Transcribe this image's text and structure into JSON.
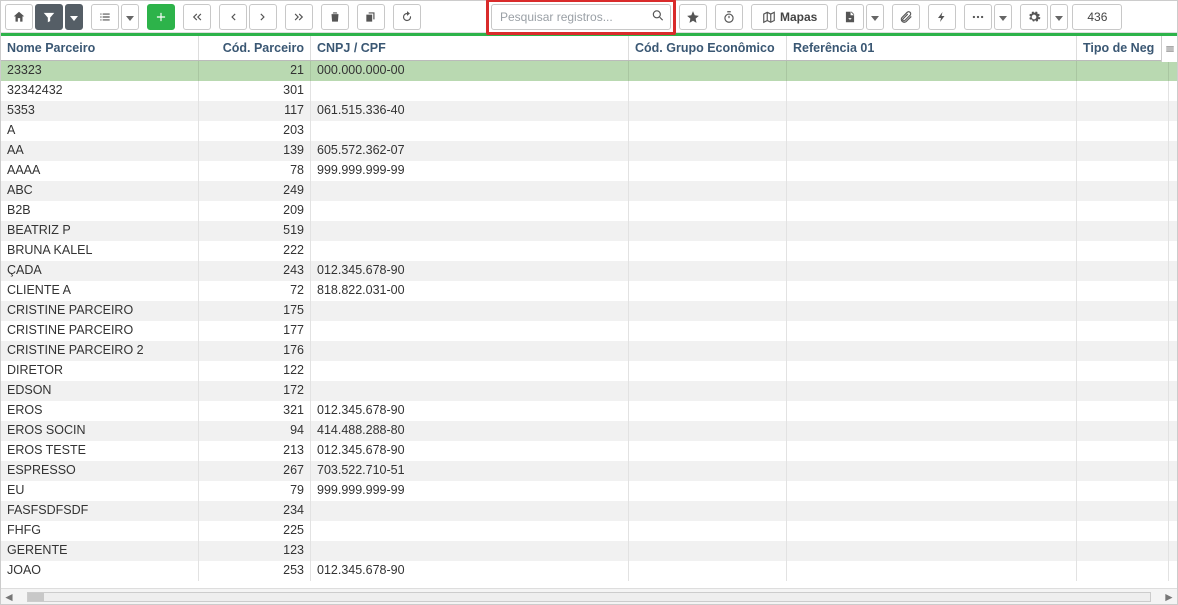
{
  "toolbar": {
    "search_placeholder": "Pesquisar registros...",
    "mapas_label": "Mapas",
    "record_count": "436"
  },
  "table": {
    "columns": [
      "Nome Parceiro",
      "Cód. Parceiro",
      "CNPJ / CPF",
      "Cód. Grupo Econômico",
      "Referência 01",
      "Tipo de Neg"
    ],
    "rows": [
      {
        "nome": "23323",
        "cod": "21",
        "cnpj": "000.000.000-00",
        "grupo": "",
        "ref": "",
        "tipo": "",
        "selected": true
      },
      {
        "nome": "32342432",
        "cod": "301",
        "cnpj": "",
        "grupo": "",
        "ref": "",
        "tipo": ""
      },
      {
        "nome": "5353",
        "cod": "117",
        "cnpj": "061.515.336-40",
        "grupo": "",
        "ref": "",
        "tipo": ""
      },
      {
        "nome": "A",
        "cod": "203",
        "cnpj": "",
        "grupo": "",
        "ref": "",
        "tipo": ""
      },
      {
        "nome": "AA",
        "cod": "139",
        "cnpj": "605.572.362-07",
        "grupo": "",
        "ref": "",
        "tipo": ""
      },
      {
        "nome": "AAAA",
        "cod": "78",
        "cnpj": "999.999.999-99",
        "grupo": "",
        "ref": "",
        "tipo": ""
      },
      {
        "nome": "ABC",
        "cod": "249",
        "cnpj": "",
        "grupo": "",
        "ref": "",
        "tipo": ""
      },
      {
        "nome": "B2B",
        "cod": "209",
        "cnpj": "",
        "grupo": "",
        "ref": "",
        "tipo": ""
      },
      {
        "nome": "BEATRIZ P",
        "cod": "519",
        "cnpj": "",
        "grupo": "",
        "ref": "",
        "tipo": ""
      },
      {
        "nome": "BRUNA KALEL",
        "cod": "222",
        "cnpj": "",
        "grupo": "",
        "ref": "",
        "tipo": ""
      },
      {
        "nome": "ÇADA",
        "cod": "243",
        "cnpj": "012.345.678-90",
        "grupo": "",
        "ref": "",
        "tipo": ""
      },
      {
        "nome": "CLIENTE A",
        "cod": "72",
        "cnpj": "818.822.031-00",
        "grupo": "",
        "ref": "",
        "tipo": ""
      },
      {
        "nome": "CRISTINE PARCEIRO",
        "cod": "175",
        "cnpj": "",
        "grupo": "",
        "ref": "",
        "tipo": ""
      },
      {
        "nome": "CRISTINE PARCEIRO",
        "cod": "177",
        "cnpj": "",
        "grupo": "",
        "ref": "",
        "tipo": ""
      },
      {
        "nome": "CRISTINE PARCEIRO 2",
        "cod": "176",
        "cnpj": "",
        "grupo": "",
        "ref": "",
        "tipo": ""
      },
      {
        "nome": "DIRETOR",
        "cod": "122",
        "cnpj": "",
        "grupo": "",
        "ref": "",
        "tipo": ""
      },
      {
        "nome": "EDSON",
        "cod": "172",
        "cnpj": "",
        "grupo": "",
        "ref": "",
        "tipo": ""
      },
      {
        "nome": "EROS",
        "cod": "321",
        "cnpj": "012.345.678-90",
        "grupo": "",
        "ref": "",
        "tipo": ""
      },
      {
        "nome": "EROS SOCIN",
        "cod": "94",
        "cnpj": "414.488.288-80",
        "grupo": "",
        "ref": "",
        "tipo": ""
      },
      {
        "nome": "EROS TESTE",
        "cod": "213",
        "cnpj": "012.345.678-90",
        "grupo": "",
        "ref": "",
        "tipo": ""
      },
      {
        "nome": "ESPRESSO",
        "cod": "267",
        "cnpj": "703.522.710-51",
        "grupo": "",
        "ref": "",
        "tipo": ""
      },
      {
        "nome": "EU",
        "cod": "79",
        "cnpj": "999.999.999-99",
        "grupo": "",
        "ref": "",
        "tipo": ""
      },
      {
        "nome": "FASFSDFSDF",
        "cod": "234",
        "cnpj": "",
        "grupo": "",
        "ref": "",
        "tipo": ""
      },
      {
        "nome": "FHFG",
        "cod": "225",
        "cnpj": "",
        "grupo": "",
        "ref": "",
        "tipo": ""
      },
      {
        "nome": "GERENTE",
        "cod": "123",
        "cnpj": "",
        "grupo": "",
        "ref": "",
        "tipo": ""
      },
      {
        "nome": "JOAO",
        "cod": "253",
        "cnpj": "012.345.678-90",
        "grupo": "",
        "ref": "",
        "tipo": ""
      }
    ]
  }
}
